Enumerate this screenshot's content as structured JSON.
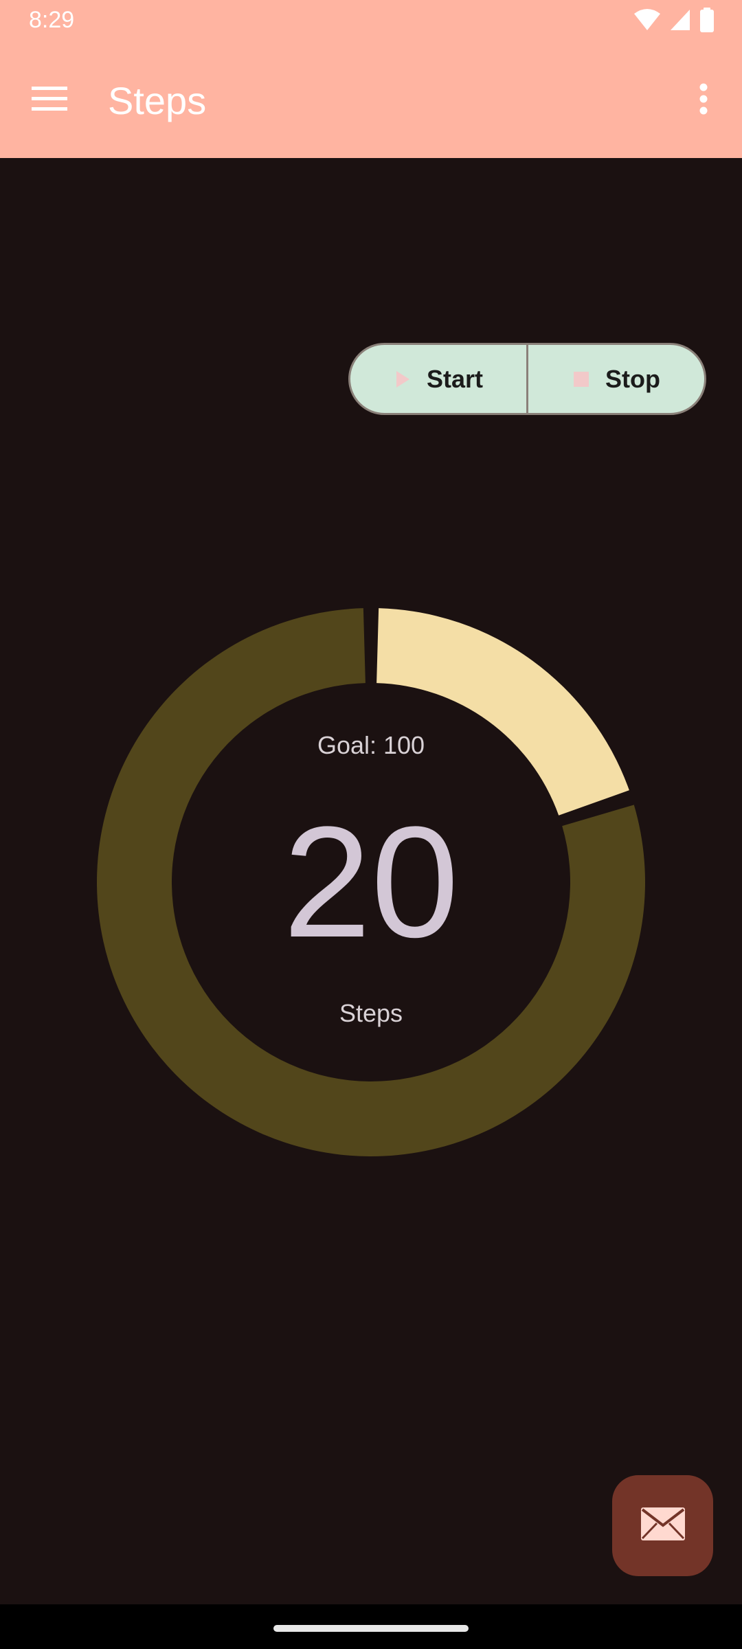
{
  "status_bar": {
    "time": "8:29",
    "icons": [
      "wifi-icon",
      "cellular-signal-icon",
      "battery-icon"
    ]
  },
  "app_bar": {
    "title": "Steps",
    "menu_icon": "hamburger-menu-icon",
    "overflow_icon": "more-vert-icon"
  },
  "controls": {
    "start_label": "Start",
    "start_icon": "play-icon",
    "stop_label": "Stop",
    "stop_icon": "stop-icon"
  },
  "progress": {
    "goal_label": "Goal: 100",
    "goal": 100,
    "count": "20",
    "value": 20,
    "unit_label": "Steps",
    "fraction": 0.2
  },
  "fab": {
    "icon": "mail-icon"
  },
  "colors": {
    "app_bar": "#ffb4a1",
    "background": "#1b1111",
    "ring_track": "#52461b",
    "ring_progress": "#f4dea6",
    "segmented_bg": "#d0e8d9",
    "fab_bg": "#733428",
    "fab_icon": "#ffd9d0"
  }
}
